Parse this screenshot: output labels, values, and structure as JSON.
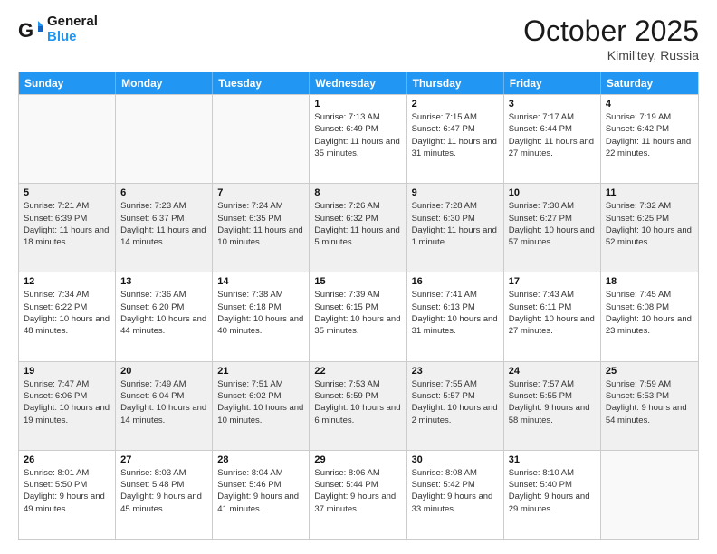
{
  "header": {
    "logo_line1": "General",
    "logo_line2": "Blue",
    "month_title": "October 2025",
    "location": "Kimil'tey, Russia"
  },
  "weekdays": [
    "Sunday",
    "Monday",
    "Tuesday",
    "Wednesday",
    "Thursday",
    "Friday",
    "Saturday"
  ],
  "rows": [
    [
      {
        "day": "",
        "sunrise": "",
        "sunset": "",
        "daylight": ""
      },
      {
        "day": "",
        "sunrise": "",
        "sunset": "",
        "daylight": ""
      },
      {
        "day": "",
        "sunrise": "",
        "sunset": "",
        "daylight": ""
      },
      {
        "day": "1",
        "sunrise": "Sunrise: 7:13 AM",
        "sunset": "Sunset: 6:49 PM",
        "daylight": "Daylight: 11 hours and 35 minutes."
      },
      {
        "day": "2",
        "sunrise": "Sunrise: 7:15 AM",
        "sunset": "Sunset: 6:47 PM",
        "daylight": "Daylight: 11 hours and 31 minutes."
      },
      {
        "day": "3",
        "sunrise": "Sunrise: 7:17 AM",
        "sunset": "Sunset: 6:44 PM",
        "daylight": "Daylight: 11 hours and 27 minutes."
      },
      {
        "day": "4",
        "sunrise": "Sunrise: 7:19 AM",
        "sunset": "Sunset: 6:42 PM",
        "daylight": "Daylight: 11 hours and 22 minutes."
      }
    ],
    [
      {
        "day": "5",
        "sunrise": "Sunrise: 7:21 AM",
        "sunset": "Sunset: 6:39 PM",
        "daylight": "Daylight: 11 hours and 18 minutes."
      },
      {
        "day": "6",
        "sunrise": "Sunrise: 7:23 AM",
        "sunset": "Sunset: 6:37 PM",
        "daylight": "Daylight: 11 hours and 14 minutes."
      },
      {
        "day": "7",
        "sunrise": "Sunrise: 7:24 AM",
        "sunset": "Sunset: 6:35 PM",
        "daylight": "Daylight: 11 hours and 10 minutes."
      },
      {
        "day": "8",
        "sunrise": "Sunrise: 7:26 AM",
        "sunset": "Sunset: 6:32 PM",
        "daylight": "Daylight: 11 hours and 5 minutes."
      },
      {
        "day": "9",
        "sunrise": "Sunrise: 7:28 AM",
        "sunset": "Sunset: 6:30 PM",
        "daylight": "Daylight: 11 hours and 1 minute."
      },
      {
        "day": "10",
        "sunrise": "Sunrise: 7:30 AM",
        "sunset": "Sunset: 6:27 PM",
        "daylight": "Daylight: 10 hours and 57 minutes."
      },
      {
        "day": "11",
        "sunrise": "Sunrise: 7:32 AM",
        "sunset": "Sunset: 6:25 PM",
        "daylight": "Daylight: 10 hours and 52 minutes."
      }
    ],
    [
      {
        "day": "12",
        "sunrise": "Sunrise: 7:34 AM",
        "sunset": "Sunset: 6:22 PM",
        "daylight": "Daylight: 10 hours and 48 minutes."
      },
      {
        "day": "13",
        "sunrise": "Sunrise: 7:36 AM",
        "sunset": "Sunset: 6:20 PM",
        "daylight": "Daylight: 10 hours and 44 minutes."
      },
      {
        "day": "14",
        "sunrise": "Sunrise: 7:38 AM",
        "sunset": "Sunset: 6:18 PM",
        "daylight": "Daylight: 10 hours and 40 minutes."
      },
      {
        "day": "15",
        "sunrise": "Sunrise: 7:39 AM",
        "sunset": "Sunset: 6:15 PM",
        "daylight": "Daylight: 10 hours and 35 minutes."
      },
      {
        "day": "16",
        "sunrise": "Sunrise: 7:41 AM",
        "sunset": "Sunset: 6:13 PM",
        "daylight": "Daylight: 10 hours and 31 minutes."
      },
      {
        "day": "17",
        "sunrise": "Sunrise: 7:43 AM",
        "sunset": "Sunset: 6:11 PM",
        "daylight": "Daylight: 10 hours and 27 minutes."
      },
      {
        "day": "18",
        "sunrise": "Sunrise: 7:45 AM",
        "sunset": "Sunset: 6:08 PM",
        "daylight": "Daylight: 10 hours and 23 minutes."
      }
    ],
    [
      {
        "day": "19",
        "sunrise": "Sunrise: 7:47 AM",
        "sunset": "Sunset: 6:06 PM",
        "daylight": "Daylight: 10 hours and 19 minutes."
      },
      {
        "day": "20",
        "sunrise": "Sunrise: 7:49 AM",
        "sunset": "Sunset: 6:04 PM",
        "daylight": "Daylight: 10 hours and 14 minutes."
      },
      {
        "day": "21",
        "sunrise": "Sunrise: 7:51 AM",
        "sunset": "Sunset: 6:02 PM",
        "daylight": "Daylight: 10 hours and 10 minutes."
      },
      {
        "day": "22",
        "sunrise": "Sunrise: 7:53 AM",
        "sunset": "Sunset: 5:59 PM",
        "daylight": "Daylight: 10 hours and 6 minutes."
      },
      {
        "day": "23",
        "sunrise": "Sunrise: 7:55 AM",
        "sunset": "Sunset: 5:57 PM",
        "daylight": "Daylight: 10 hours and 2 minutes."
      },
      {
        "day": "24",
        "sunrise": "Sunrise: 7:57 AM",
        "sunset": "Sunset: 5:55 PM",
        "daylight": "Daylight: 9 hours and 58 minutes."
      },
      {
        "day": "25",
        "sunrise": "Sunrise: 7:59 AM",
        "sunset": "Sunset: 5:53 PM",
        "daylight": "Daylight: 9 hours and 54 minutes."
      }
    ],
    [
      {
        "day": "26",
        "sunrise": "Sunrise: 8:01 AM",
        "sunset": "Sunset: 5:50 PM",
        "daylight": "Daylight: 9 hours and 49 minutes."
      },
      {
        "day": "27",
        "sunrise": "Sunrise: 8:03 AM",
        "sunset": "Sunset: 5:48 PM",
        "daylight": "Daylight: 9 hours and 45 minutes."
      },
      {
        "day": "28",
        "sunrise": "Sunrise: 8:04 AM",
        "sunset": "Sunset: 5:46 PM",
        "daylight": "Daylight: 9 hours and 41 minutes."
      },
      {
        "day": "29",
        "sunrise": "Sunrise: 8:06 AM",
        "sunset": "Sunset: 5:44 PM",
        "daylight": "Daylight: 9 hours and 37 minutes."
      },
      {
        "day": "30",
        "sunrise": "Sunrise: 8:08 AM",
        "sunset": "Sunset: 5:42 PM",
        "daylight": "Daylight: 9 hours and 33 minutes."
      },
      {
        "day": "31",
        "sunrise": "Sunrise: 8:10 AM",
        "sunset": "Sunset: 5:40 PM",
        "daylight": "Daylight: 9 hours and 29 minutes."
      },
      {
        "day": "",
        "sunrise": "",
        "sunset": "",
        "daylight": ""
      }
    ]
  ]
}
